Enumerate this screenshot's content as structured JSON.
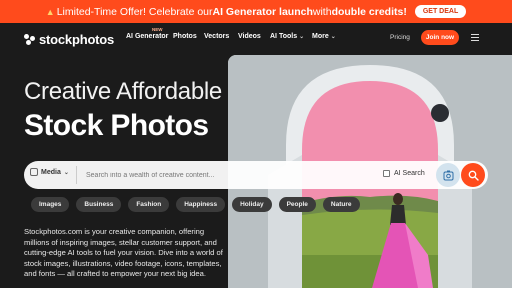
{
  "promo": {
    "text_1": "Limited-Time Offer! Celebrate our ",
    "highlight_1": "AI Generator launch",
    "text_2": " with ",
    "highlight_2": "double credits!",
    "button": "GET DEAL"
  },
  "nav": {
    "brand": "stockphotos",
    "new_badge": "NEW",
    "items": [
      "AI Generator",
      "Photos",
      "Vectors",
      "Videos",
      "AI Tools",
      "More"
    ],
    "pricing": "Pricing",
    "join": "Join now"
  },
  "hero": {
    "title_line1": "Creative Affordable",
    "title_line2": "Stock Photos"
  },
  "search": {
    "media_label": "Media",
    "placeholder": "Search into a wealth of creative content...",
    "ai_search_label": "AI Search"
  },
  "chips": [
    "Images",
    "Business",
    "Fashion",
    "Happiness",
    "Holiday",
    "People",
    "Nature"
  ],
  "description": "Stockphotos.com is your creative companion, offering millions of inspiring images, stellar customer support, and cutting-edge AI tools to fuel your vision. Dive into a world of stock images, illustrations, video footage, icons, templates, and fonts — all crafted to empower your next big idea.",
  "colors": {
    "accent": "#ff4b1c",
    "background": "#1b1b1b"
  }
}
